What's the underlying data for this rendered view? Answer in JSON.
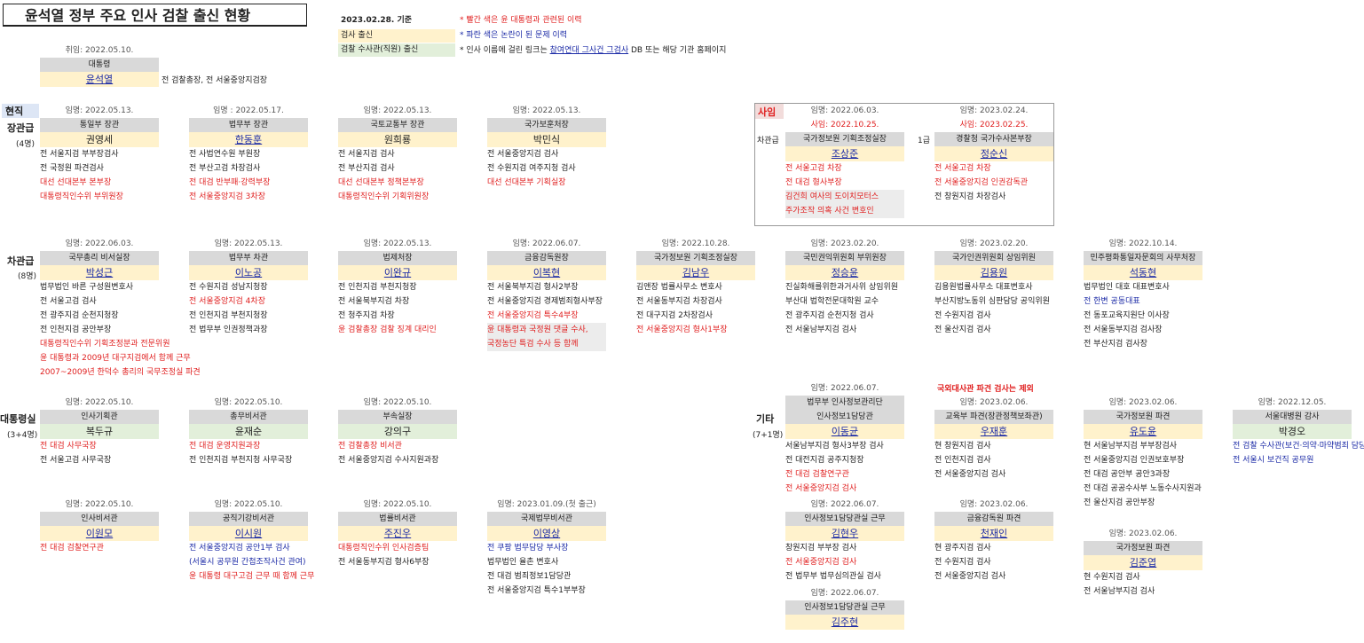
{
  "page": {
    "title": "윤석열 정부 주요 인사 검찰 출신 현황",
    "as_of": "2023.02.28. 기준",
    "legend_prosecutor": "검사 출신",
    "legend_investigator": "검찰 수사관(직원) 출신",
    "note1": "* 빨간 색은 윤 대통령과 관련된 이력",
    "note2": "* 파란 색은 논란이 된 문제 이력",
    "note3_pre": "* 인사 이름에 걸린 링크는 ",
    "note3_link": "참여연대 그사건 그검사",
    "note3_post": " DB 또는 해당 기관 홈페이지"
  },
  "president": {
    "date": "취임: 2022.05.10.",
    "role": "대통령",
    "name": "윤석열",
    "note": "전 검찰총장, 전 서울중앙지검장"
  },
  "sections": {
    "current": "현직",
    "minister": "장관급",
    "minister_count": "(4명)",
    "vice": "차관급",
    "vice_count": "(8명)",
    "office": "대통령실",
    "office_count": "(3+4명)",
    "resigned": "사임",
    "other": "기타",
    "other_count": "(7+1명)",
    "overseas_note": "국외대사관 파견 검사는 제외"
  },
  "ministers": [
    {
      "date": "임명: 2022.05.13.",
      "role": "통일부 장관",
      "name": "권영세",
      "lines": [
        {
          "t": "전 서울지검 부부장검사",
          "c": ""
        },
        {
          "t": "전 국정원 파견검사",
          "c": ""
        },
        {
          "t": "대선 선대본부 본부장",
          "c": "red"
        },
        {
          "t": "대통령직인수위 부위원장",
          "c": "red"
        }
      ]
    },
    {
      "date": "임명 : 2022.05.17.",
      "role": "법무부 장관",
      "name": "한동훈",
      "lines": [
        {
          "t": "전 사법연수원 부원장",
          "c": ""
        },
        {
          "t": "전 부산고검 차장검사",
          "c": ""
        },
        {
          "t": "전 대검 반부패·강력부장",
          "c": "red"
        },
        {
          "t": "전 서울중앙지검 3차장",
          "c": "red"
        }
      ]
    },
    {
      "date": "임명: 2022.05.13.",
      "role": "국토교통부 장관",
      "name": "원희룡",
      "lines": [
        {
          "t": "전 서울지검 검사",
          "c": ""
        },
        {
          "t": "전 부산지검 검사",
          "c": ""
        },
        {
          "t": "대선 선대본부 정책본부장",
          "c": "red"
        },
        {
          "t": "대통령직인수위 기획위원장",
          "c": "red"
        }
      ]
    },
    {
      "date": "임명: 2022.05.13.",
      "role": "국가보훈처장",
      "name": "박민식",
      "lines": [
        {
          "t": "전 서울중앙지검 검사",
          "c": ""
        },
        {
          "t": "전 수원지검 여주지청 검사",
          "c": ""
        },
        {
          "t": "대선 선대본부 기획실장",
          "c": "red"
        }
      ]
    }
  ],
  "resigned": [
    {
      "date": "임명: 2022.06.03.",
      "sub": "사임: 2022.10.25.",
      "rank": "차관급",
      "role": "국가정보원 기획조정실장",
      "name": "조상준",
      "lines": [
        {
          "t": "전 서울고검 차장",
          "c": "red"
        },
        {
          "t": "전 대검 형사부장",
          "c": "red"
        },
        {
          "t": "김건희 여사의 도이치모터스",
          "c": "red shade"
        },
        {
          "t": "주가조작 의혹 사건 변호인",
          "c": "red shade"
        }
      ]
    },
    {
      "date": "임명: 2023.02.24.",
      "sub": "사임: 2023.02.25.",
      "rank": "1급",
      "role": "경찰청 국가수사본부장",
      "name": "정순신",
      "lines": [
        {
          "t": "전 서울고검 차장",
          "c": "red"
        },
        {
          "t": "전 서울중앙지검 인권감독관",
          "c": "red"
        },
        {
          "t": "전 창원지검 차장검사",
          "c": ""
        }
      ]
    }
  ],
  "vice": [
    {
      "date": "임명: 2022.06.03.",
      "role": "국무총리 비서실장",
      "name": "박성근",
      "lines": [
        {
          "t": "법무법인 바른 구성원변호사",
          "c": ""
        },
        {
          "t": "전 서울고검 검사",
          "c": ""
        },
        {
          "t": "전 광주지검 순천지청장",
          "c": ""
        },
        {
          "t": "전 인천지검 공안부장",
          "c": ""
        },
        {
          "t": "대통령직인수위 기획조정분과 전문위원",
          "c": "red"
        },
        {
          "t": "윤 대통령과 2009년 대구지검에서 함께 근무",
          "c": "red"
        },
        {
          "t": "2007~2009년 한덕수 총리의 국무조정실 파견",
          "c": "red"
        }
      ]
    },
    {
      "date": "임명: 2022.05.13.",
      "role": "법무부 차관",
      "name": "이노공",
      "lines": [
        {
          "t": "전 수원지검 성남지청장",
          "c": ""
        },
        {
          "t": "전 서울중앙지검 4차장",
          "c": "red"
        },
        {
          "t": "전 인천지검 부천지청장",
          "c": ""
        },
        {
          "t": "전 법무부 인권정책과장",
          "c": ""
        }
      ]
    },
    {
      "date": "임명: 2022.05.13.",
      "role": "법제처장",
      "name": "이완규",
      "lines": [
        {
          "t": "전 인천지검 부천지청장",
          "c": ""
        },
        {
          "t": "전 서울북부지검 차장",
          "c": ""
        },
        {
          "t": "전 청주지검 차장",
          "c": ""
        },
        {
          "t": "윤 검찰총장 검찰 징계 대리인",
          "c": "red"
        }
      ]
    },
    {
      "date": "임명: 2022.06.07.",
      "role": "금융감독원장",
      "name": "이복현",
      "lines": [
        {
          "t": "전 서울북부지검 형사2부장",
          "c": ""
        },
        {
          "t": "전 서울중앙지검 경제범죄형사부장",
          "c": ""
        },
        {
          "t": "전 서울중앙지검 특수4부장",
          "c": "red"
        },
        {
          "t": "윤 대통령과 국정원 댓글 수사,",
          "c": "red shade"
        },
        {
          "t": "국정농단 특검 수사 등 함께",
          "c": "red shade"
        }
      ]
    },
    {
      "date": "임명: 2022.10.28.",
      "role": "국가정보원 기획조정실장",
      "name": "김남우",
      "lines": [
        {
          "t": "김앤장 법률사무소 변호사",
          "c": ""
        },
        {
          "t": "전 서울동부지검 차장검사",
          "c": ""
        },
        {
          "t": "전 대구지검 2차장검사",
          "c": ""
        },
        {
          "t": "전 서울중앙지검 형사1부장",
          "c": "red"
        }
      ]
    },
    {
      "date": "임명: 2023.02.20.",
      "role": "국민권익위원회 부위원장",
      "name": "정승윤",
      "lines": [
        {
          "t": "진실화해를위한과거사위 상임위원",
          "c": ""
        },
        {
          "t": "부산대 법학전문대학원 교수",
          "c": ""
        },
        {
          "t": "전 광주지검 순천지청 검사",
          "c": ""
        },
        {
          "t": "전 서울남부지검 검사",
          "c": ""
        }
      ]
    },
    {
      "date": "임명: 2023.02.20.",
      "role": "국가인권위원회 상임위원",
      "name": "김용원",
      "lines": [
        {
          "t": "김용원법률사무소 대표변호사",
          "c": ""
        },
        {
          "t": "부산지방노동위 심판담당 공익위원",
          "c": ""
        },
        {
          "t": "전 수원지검 검사",
          "c": ""
        },
        {
          "t": "전 울산지검 검사",
          "c": ""
        }
      ]
    },
    {
      "date": "임명: 2022.10.14.",
      "role": "민주평화통일자문회의 사무처장",
      "name": "석동현",
      "lines": [
        {
          "t": "법무법인 대호 대표변호사",
          "c": ""
        },
        {
          "t": "전 한변 공동대표",
          "c": "blue"
        },
        {
          "t": "전 동포교육지원단 이사장",
          "c": ""
        },
        {
          "t": "전 서울동부지검 검사장",
          "c": ""
        },
        {
          "t": "전 부산지검 검사장",
          "c": ""
        }
      ]
    }
  ],
  "office_row1": [
    {
      "date": "임명: 2022.05.10.",
      "role": "인사기획관",
      "name": "복두규",
      "lines": [
        {
          "t": "전 대검 사무국장",
          "c": "red"
        },
        {
          "t": "전 서울고검 사무국장",
          "c": ""
        }
      ]
    },
    {
      "date": "임명: 2022.05.10.",
      "role": "총무비서관",
      "name": "윤재순",
      "lines": [
        {
          "t": "전 대검 운영지원과장",
          "c": "red"
        },
        {
          "t": "전 인천지검 부천지청 사무국장",
          "c": ""
        }
      ]
    },
    {
      "date": "임명: 2022.05.10.",
      "role": "부속실장",
      "name": "강의구",
      "lines": [
        {
          "t": "전 검찰총장 비서관",
          "c": "red"
        },
        {
          "t": "전 서울중앙지검 수사지원과장",
          "c": ""
        }
      ]
    }
  ],
  "office_row2": [
    {
      "date": "임명: 2022.05.10.",
      "role": "인사비서관",
      "name": "이원모",
      "lines": [
        {
          "t": "전 대검 검찰연구관",
          "c": "red"
        }
      ]
    },
    {
      "date": "임명: 2022.05.10.",
      "role": "공직기강비서관",
      "name": "이시원",
      "lines": [
        {
          "t": "전 서울중앙지검 공안1부 검사",
          "c": "blue"
        },
        {
          "t": "(서울시 공무원 간첩조작사건 관여)",
          "c": "blue"
        },
        {
          "t": "윤 대통령 대구고검 근무 때 함께 근무",
          "c": "red"
        }
      ]
    },
    {
      "date": "임명: 2022.05.10.",
      "role": "법률비서관",
      "name": "주진우",
      "lines": [
        {
          "t": "대통령직인수위 인사검증팀",
          "c": "red"
        },
        {
          "t": "전 서울동부지검 형사6부장",
          "c": ""
        }
      ]
    },
    {
      "date": "임명: 2023.01.09.(첫 출근)",
      "role": "국제법무비서관",
      "name": "이영상",
      "lines": [
        {
          "t": "전 쿠팡 법무담당 부사장",
          "c": "blue"
        },
        {
          "t": "법무법인 율촌 변호사",
          "c": ""
        },
        {
          "t": "전 대검 범죄정보1담당관",
          "c": ""
        },
        {
          "t": "전 서울중앙지검 특수1부부장",
          "c": ""
        }
      ]
    }
  ],
  "other_col1": [
    {
      "date": "임명: 2022.06.07.",
      "role": "법무부 인사정보관리단",
      "role2": "인사정보1담당관",
      "name": "이동균",
      "lines": [
        {
          "t": "서울남부지검 형사3부장 검사",
          "c": ""
        },
        {
          "t": "전 대전지검 공주지청장",
          "c": ""
        },
        {
          "t": "전 대검 검찰연구관",
          "c": "red"
        },
        {
          "t": "전 서울중앙지검 검사",
          "c": "red"
        }
      ]
    },
    {
      "date": "임명: 2022.06.07.",
      "role": "인사정보1담당관실 근무",
      "name": "김현우",
      "lines": [
        {
          "t": "창원지검 부부장 검사",
          "c": ""
        },
        {
          "t": "전 서울중앙지검 검사",
          "c": "red"
        },
        {
          "t": "전 법무부 법무심의관실 검사",
          "c": ""
        }
      ]
    },
    {
      "date": "임명: 2022.06.07.",
      "role": "인사정보1담당관실 근무",
      "name": "김주현",
      "lines": []
    }
  ],
  "other_col2": [
    {
      "date": "임명: 2023.02.06.",
      "role": "교육부 파견(장관정책보좌관)",
      "name": "우재훈",
      "lines": [
        {
          "t": "현 창원지검 검사",
          "c": ""
        },
        {
          "t": "전 인천지검 검사",
          "c": ""
        },
        {
          "t": "전 서울중앙지검 검사",
          "c": ""
        }
      ]
    },
    {
      "date": "임명: 2023.02.06.",
      "role": "금융감독원 파견",
      "name": "천재인",
      "lines": [
        {
          "t": "현 광주지검 검사",
          "c": ""
        },
        {
          "t": "전 수원지검 검사",
          "c": ""
        },
        {
          "t": "전 서울중앙지검 검사",
          "c": ""
        }
      ]
    }
  ],
  "other_col3": [
    {
      "date": "임명: 2023.02.06.",
      "role": "국가정보원 파견",
      "name": "유도윤",
      "lines": [
        {
          "t": "현 서울남부지검 부부장검사",
          "c": ""
        },
        {
          "t": "전 서울중앙지검 인권보호부장",
          "c": ""
        },
        {
          "t": "전 대검 공안부 공안3과장",
          "c": ""
        },
        {
          "t": "전 대검 공공수사부 노동수사지원과",
          "c": ""
        },
        {
          "t": "전 울산지검 공안부장",
          "c": ""
        }
      ]
    },
    {
      "date": "임명: 2023.02.06.",
      "role": "국가정보원 파견",
      "name": "김준엽",
      "lines": [
        {
          "t": "현 수원지검 검사",
          "c": ""
        },
        {
          "t": "전 서울남부지검 검사",
          "c": ""
        }
      ]
    }
  ],
  "other_col4": [
    {
      "date": "임명: 2022.12.05.",
      "role": "서울대병원 감사",
      "name": "박경오",
      "lines": [
        {
          "t": "전 검찰 수사관(보건·의약·마약범죄 담당)",
          "c": "blue"
        },
        {
          "t": "전 서울시 보건직 공무원",
          "c": "blue"
        }
      ]
    }
  ]
}
